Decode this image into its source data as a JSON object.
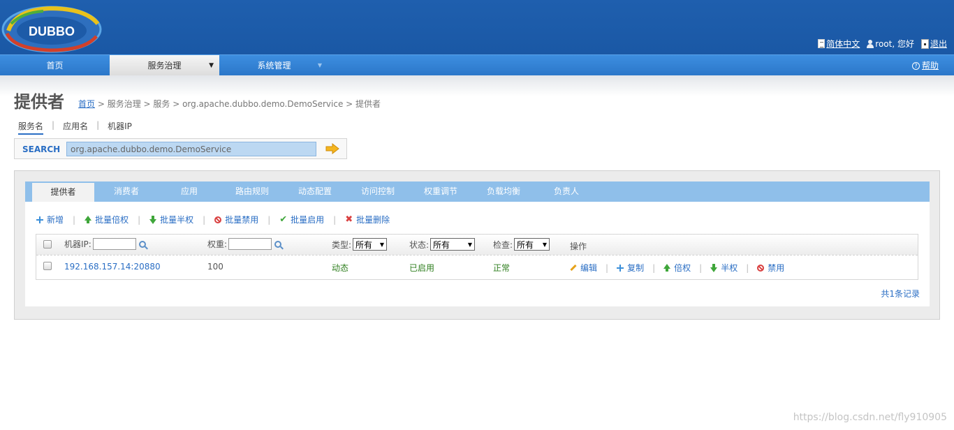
{
  "header": {
    "logo_text": "DUBBO",
    "lang_label": "简体中文",
    "user_label": "root, 您好",
    "logout_label": "退出"
  },
  "nav": {
    "items": [
      {
        "label": "首页"
      },
      {
        "label": "服务治理",
        "dropdown": "▼"
      },
      {
        "label": "系统管理",
        "dropdown": "▼"
      }
    ],
    "help_label": "帮助"
  },
  "page": {
    "title": "提供者",
    "breadcrumb": {
      "home": "首页",
      "rest": "> 服务治理 > 服务 > org.apache.dubbo.demo.DemoService > 提供者"
    }
  },
  "search_tabs": [
    "服务名",
    "应用名",
    "机器IP"
  ],
  "search": {
    "label": "SEARCH",
    "value": "org.apache.dubbo.demo.DemoService"
  },
  "tabs": [
    "提供者",
    "消费者",
    "应用",
    "路由规则",
    "动态配置",
    "访问控制",
    "权重调节",
    "负载均衡",
    "负责人"
  ],
  "toolbar": {
    "add": "新增",
    "batch_double": "批量倍权",
    "batch_half": "批量半权",
    "batch_disable": "批量禁用",
    "batch_enable": "批量启用",
    "batch_delete": "批量删除"
  },
  "table": {
    "headers": {
      "ip": "机器IP:",
      "weight": "权重:",
      "type": "类型:",
      "type_value": "所有",
      "status": "状态:",
      "status_value": "所有",
      "check": "检查:",
      "check_value": "所有",
      "actions": "操作"
    },
    "rows": [
      {
        "address": "192.168.157.14:20880",
        "weight": "100",
        "type": "动态",
        "status": "已启用",
        "check": "正常",
        "actions": {
          "edit": "编辑",
          "copy": "复制",
          "double": "倍权",
          "half": "半权",
          "disable": "禁用"
        }
      }
    ]
  },
  "total_label": "共1条记录",
  "watermark": "https://blog.csdn.net/fly910905",
  "colors": {
    "header_bg": "#1f5fae",
    "nav_bg": "#2b77c9",
    "tab_bar": "#8fbfea",
    "link": "#2a6ec4"
  }
}
